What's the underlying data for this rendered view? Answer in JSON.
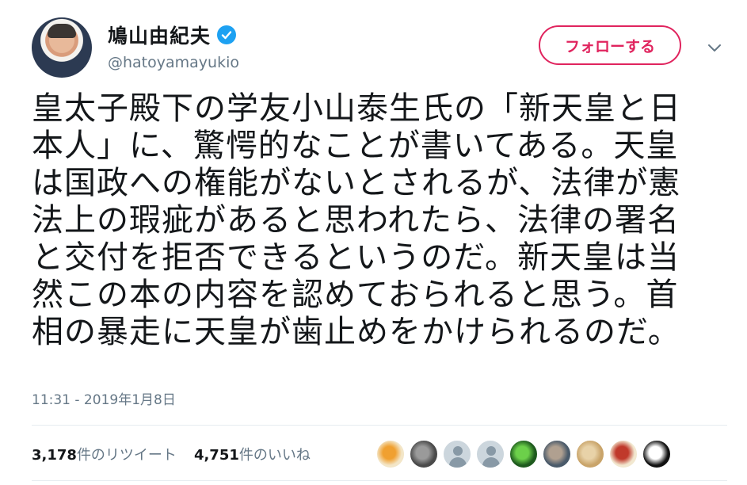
{
  "user": {
    "display_name": "鳩山由紀夫",
    "handle": "@hatoyamayukio"
  },
  "follow_button": {
    "label": "フォローする"
  },
  "tweet": {
    "text": "皇太子殿下の学友小山泰生氏の「新天皇と日\n本人」に、驚愕的なことが書いてある。天皇\nは国政への権能がないとされるが、法律が憲\n法上の瑕疵があると思われたら、法律の署名\nと交付を拒否できるというのだ。新天皇は当\n然この本の内容を認めておられると思う。首\n相の暴走に天皇が歯止めをかけられるのだ。",
    "timestamp": "11:31 - 2019年1月8日"
  },
  "stats": {
    "retweets_count": "3,178",
    "retweets_label": "件のリツイート",
    "likes_count": "4,751",
    "likes_label": "件のいいね"
  },
  "likers": [
    {
      "kind": "illustration",
      "color": "#f3e6c8",
      "accent": "#f0a030"
    },
    {
      "kind": "photo",
      "color": "#4a4a4a",
      "accent": "#9a9a9a"
    },
    {
      "kind": "default",
      "color": "#ccd6dd",
      "accent": "#8899a6"
    },
    {
      "kind": "default",
      "color": "#ccd6dd",
      "accent": "#8899a6"
    },
    {
      "kind": "photo",
      "color": "#1e5a1e",
      "accent": "#6cd04a"
    },
    {
      "kind": "photo",
      "color": "#4a5a6a",
      "accent": "#b0a090"
    },
    {
      "kind": "photo",
      "color": "#c9a46a",
      "accent": "#e8d2a8"
    },
    {
      "kind": "illustration",
      "color": "#f2e8d0",
      "accent": "#c0392b"
    },
    {
      "kind": "icon",
      "color": "#111111",
      "accent": "#ffffff"
    }
  ],
  "colors": {
    "accent_follow": "#e0245e",
    "verified": "#1da1f2",
    "secondary_text": "#657786"
  }
}
